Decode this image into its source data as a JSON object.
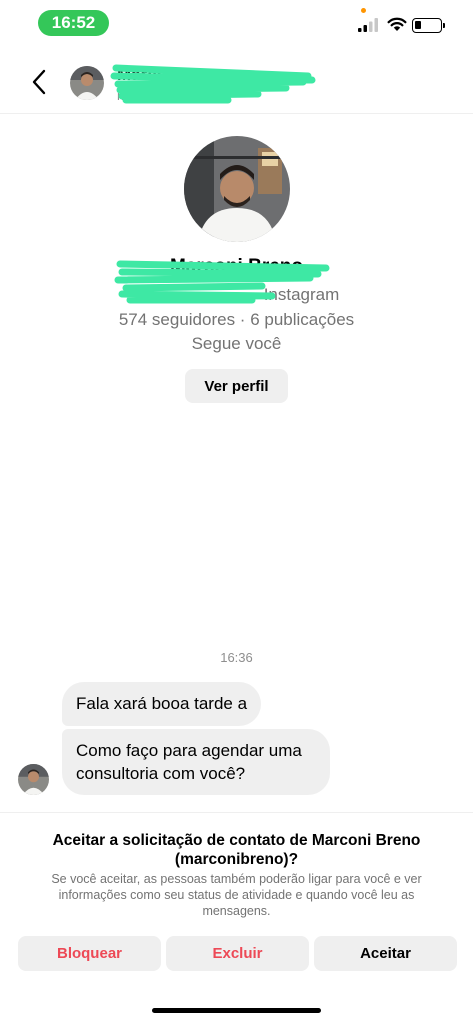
{
  "status_bar": {
    "time": "16:52",
    "icons": [
      "signal-icon",
      "wifi-icon",
      "battery-icon"
    ],
    "time_color": "#34c759"
  },
  "header": {
    "name": "Marconi Breno",
    "username": "marconibreno",
    "back_icon": "chevron-left-icon"
  },
  "profile": {
    "name": "Marconi Breno",
    "subtitle_visible": "Instagram",
    "stats": "574 seguidores · 6 publicações",
    "follows_you": "Segue você",
    "view_profile_label": "Ver perfil"
  },
  "conversation": {
    "timestamp": "16:36",
    "messages": [
      {
        "text": "Fala xará booa tarde a"
      },
      {
        "text": "Como faço para agendar uma consultoria com você?"
      }
    ]
  },
  "request": {
    "title": "Aceitar a solicitação de contato de Marconi Breno (marconibreno)?",
    "description": "Se você aceitar, as pessoas também poderão ligar para você e ver informações como seu status de atividade e quando você leu as mensagens.",
    "buttons": {
      "block": "Bloquear",
      "delete": "Excluir",
      "accept": "Aceitar"
    }
  },
  "colors": {
    "danger": "#ed4956",
    "redaction": "#3ee8a4",
    "button_bg": "#efefef"
  }
}
